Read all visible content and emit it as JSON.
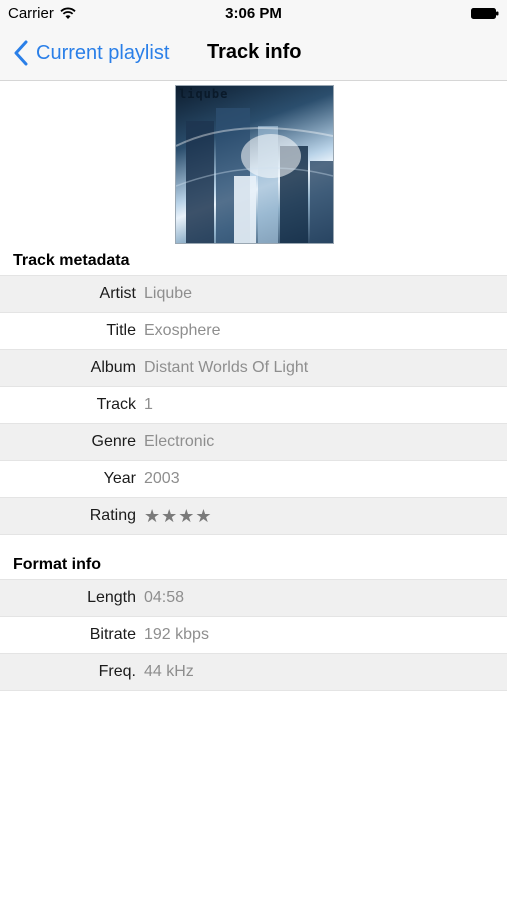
{
  "status_bar": {
    "carrier": "Carrier",
    "time": "3:06 PM",
    "icons": [
      "wifi-icon",
      "battery-icon"
    ]
  },
  "nav": {
    "back_label": "Current playlist",
    "title": "Track info",
    "accent": "#2a7fe8"
  },
  "cover": {
    "brand_text": "liqube"
  },
  "metadata": {
    "title": "Track metadata",
    "rows": [
      {
        "label": "Artist",
        "value": "Liqube"
      },
      {
        "label": "Title",
        "value": "Exosphere"
      },
      {
        "label": "Album",
        "value": "Distant Worlds Of Light"
      },
      {
        "label": "Track",
        "value": "1"
      },
      {
        "label": "Genre",
        "value": "Electronic"
      },
      {
        "label": "Year",
        "value": "2003"
      },
      {
        "label": "Rating",
        "value": "★★★★"
      }
    ]
  },
  "format": {
    "title": "Format info",
    "rows": [
      {
        "label": "Length",
        "value": "04:58"
      },
      {
        "label": "Bitrate",
        "value": "192 kbps"
      },
      {
        "label": "Freq.",
        "value": "44 kHz"
      }
    ]
  }
}
